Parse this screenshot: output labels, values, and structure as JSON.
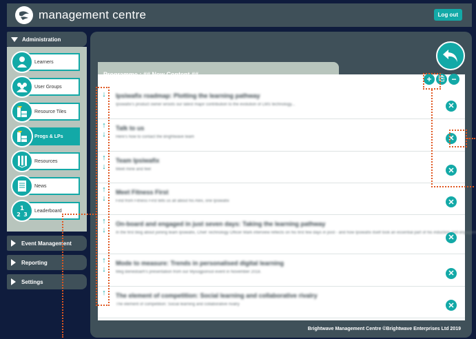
{
  "app": {
    "title": "management centre",
    "logout_label": "Log out"
  },
  "sidebar": {
    "admin_label": "Administration",
    "items": [
      {
        "label": "Learners",
        "icon": "person-icon"
      },
      {
        "label": "User Groups",
        "icon": "group-icon"
      },
      {
        "label": "Resource Tiles",
        "icon": "tiles-icon"
      },
      {
        "label": "Progs & LPs",
        "icon": "programmes-icon",
        "active": true
      },
      {
        "label": "Resources",
        "icon": "resources-icon"
      },
      {
        "label": "News",
        "icon": "news-icon"
      },
      {
        "label": "Leaderboard",
        "icon": "leaderboard-icon"
      }
    ],
    "sections": [
      {
        "label": "Event Management"
      },
      {
        "label": "Reporting"
      },
      {
        "label": "Settings"
      }
    ]
  },
  "main": {
    "tab_title": "Programme : ## New Content ##",
    "rows": [
      {
        "title": "Ipsiwafix roadmap: Plotting the learning pathway",
        "desc": "Ipsiwafix's product owner wroots our latest major contribution to the evolution of LMS technology...",
        "up": false,
        "down": true
      },
      {
        "title": "Talk to us",
        "desc": "Here's how to contact the Brightwave team",
        "up": true,
        "down": true
      },
      {
        "title": "Team Ipsiwafix",
        "desc": "Meet mine and feel",
        "up": true,
        "down": true
      },
      {
        "title": "Meet Fitness First",
        "desc": "Find from Fitness First tells us all about his Alex, one Ipsiwafix",
        "up": true,
        "down": true
      },
      {
        "title": "On-board and engaged in just seven days: Taking the learning pathway",
        "desc": "In the first blog about joining team Ipsiwafix, Chief Technology Officer Mark interview reflects on his first few days in post - and how Ipsiwafix itself took an essential part of his induction and engagement",
        "up": true,
        "down": true
      },
      {
        "title": "Mode to measure: Trends in personalised digital learning",
        "desc": "Meg Benedoarh's presentation from our Mysogponsol event in November 2018.",
        "up": true,
        "down": true
      },
      {
        "title": "The element of competition: Social learning and collaborative rivalry",
        "desc": "The element of competition: Social learning and collaborative rivalry",
        "up": true,
        "down": false
      }
    ],
    "footer": "Brightwave Management Centre ©Brightwave Enterprises Ltd 2019",
    "toolbar": {
      "add": "+",
      "save": "⎘",
      "remove": "−"
    },
    "delete_glyph": "✕",
    "up_glyph": "↑",
    "down_glyph": "↓"
  },
  "colors": {
    "accent": "#13a9a7",
    "header": "#3f5059",
    "sidebar_bg": "#b8c5bd",
    "annotation": "#e0561f"
  }
}
